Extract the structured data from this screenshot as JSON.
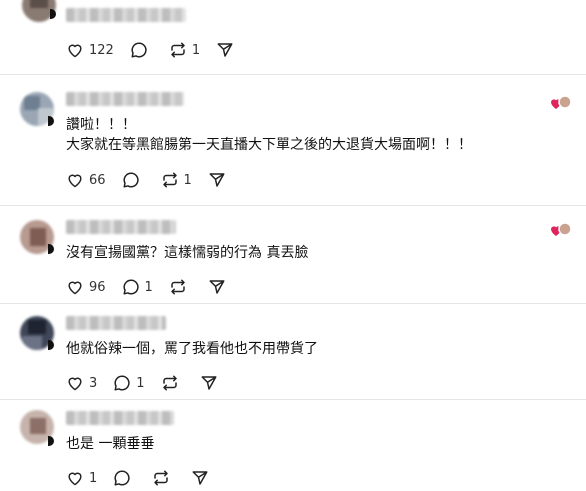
{
  "posts": [
    {
      "text_lines": [],
      "actions": {
        "likes": "122",
        "comments": "",
        "reposts": "1"
      },
      "liked_by_author": false
    },
    {
      "text_lines": [
        "讚啦！！！",
        "大家就在等黑館腸第一天直播大下單之後的大退貨大場面啊！！！"
      ],
      "actions": {
        "likes": "66",
        "comments": "",
        "reposts": "1"
      },
      "liked_by_author": true
    },
    {
      "text_lines": [
        "沒有宣揚國黨？這樣懦弱的行為 真丟臉"
      ],
      "actions": {
        "likes": "96",
        "comments": "1",
        "reposts": ""
      },
      "liked_by_author": true
    },
    {
      "text_lines": [
        "他就俗辣一個，罵了我看他也不用帶貨了"
      ],
      "actions": {
        "likes": "3",
        "comments": "1",
        "reposts": ""
      },
      "liked_by_author": false
    },
    {
      "text_lines": [
        "也是 一顆垂垂"
      ],
      "actions": {
        "likes": "1",
        "comments": "",
        "reposts": ""
      },
      "liked_by_author": false
    }
  ],
  "icons": {
    "like": "heart-outline-icon",
    "comment": "speech-bubble-icon",
    "repost": "repost-arrows-icon",
    "share": "paper-plane-icon",
    "author_like": "heart-with-avatar-icon"
  },
  "colors": {
    "text": "#111111",
    "icon": "#222222",
    "divider": "#e6e6e6",
    "heart_badge": "#e0245e"
  }
}
